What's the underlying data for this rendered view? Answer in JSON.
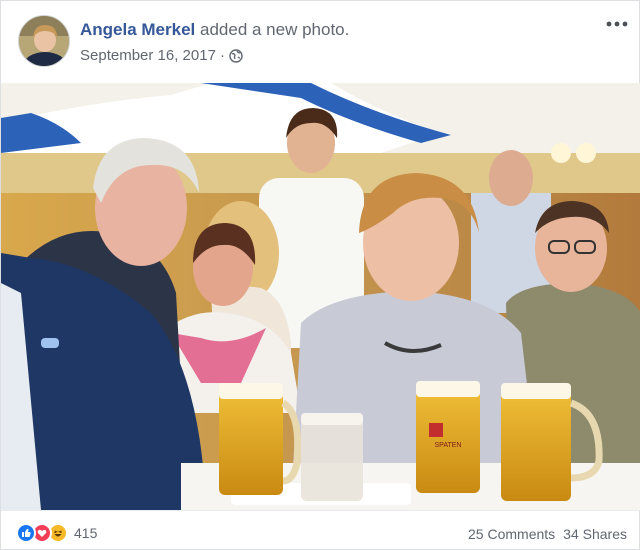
{
  "post": {
    "author": "Angela Merkel",
    "action": "added a new photo.",
    "date": "September 16, 2017",
    "separator": "·",
    "privacy_icon": "globe-icon",
    "more_icon": "more-options-icon"
  },
  "photo": {
    "mug_logo_text": "SPATEN"
  },
  "footer": {
    "reaction_icons": [
      "like-icon",
      "love-icon",
      "haha-icon"
    ],
    "reaction_count": "415",
    "comments": "25 Comments",
    "shares": "34 Shares"
  },
  "colors": {
    "link": "#365899",
    "secondary_text": "#616770",
    "like": "#1877f2",
    "love": "#f33e58",
    "haha": "#f7b928"
  }
}
